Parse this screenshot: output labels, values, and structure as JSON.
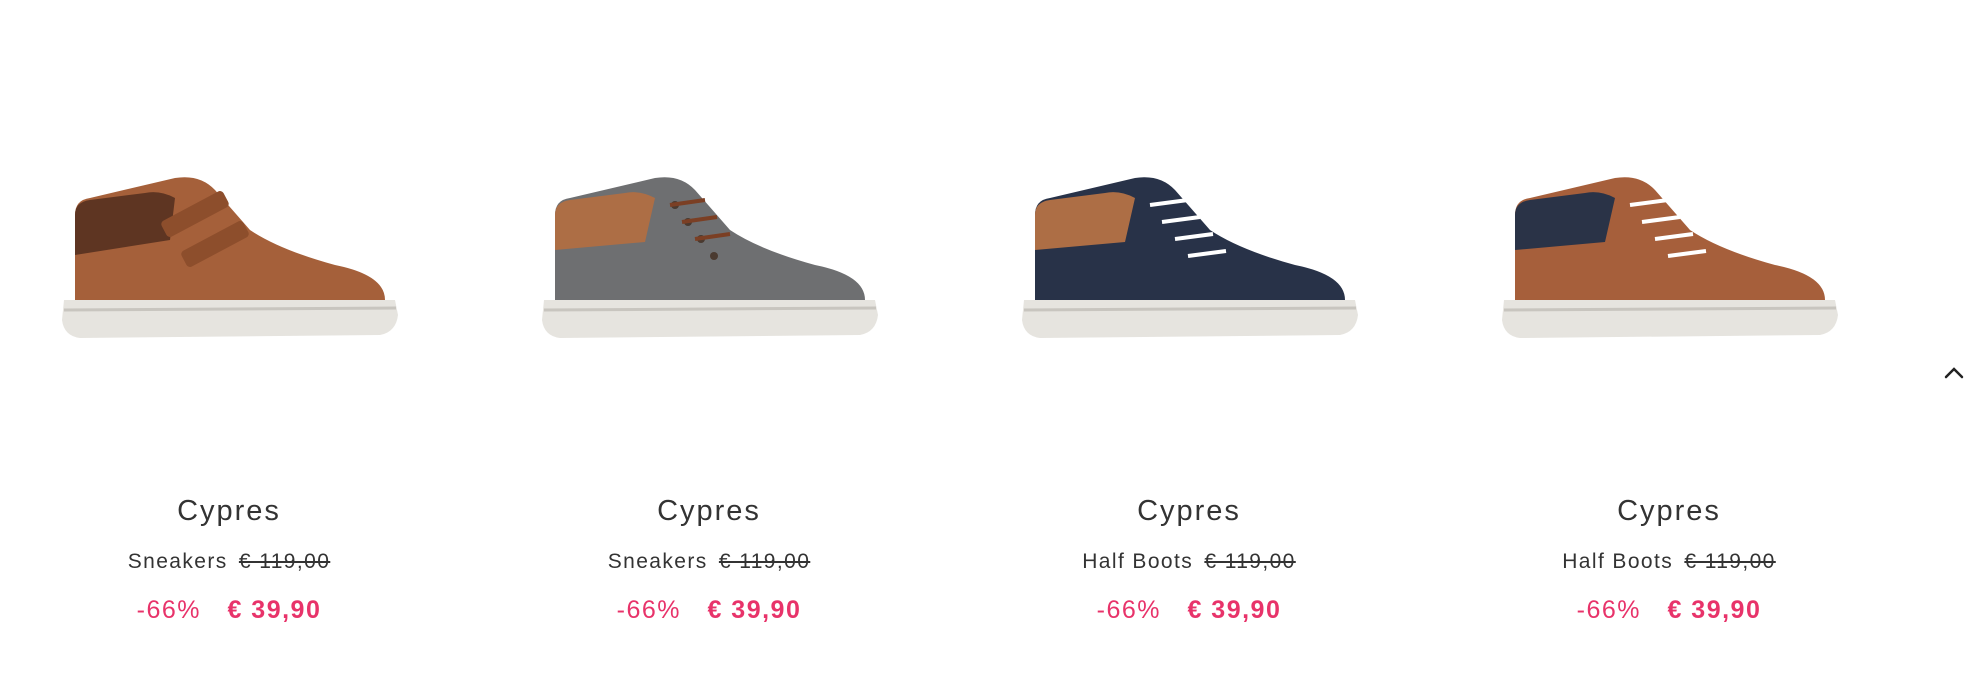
{
  "products": [
    {
      "brand": "Cypres",
      "type": "Sneakers",
      "old_price": "€ 119,00",
      "discount": "-66%",
      "new_price": "€ 39,90",
      "colors": {
        "upper": "#a5603a",
        "collar": "#5e3522",
        "sole": "#e6e4df"
      }
    },
    {
      "brand": "Cypres",
      "type": "Sneakers",
      "old_price": "€ 119,00",
      "discount": "-66%",
      "new_price": "€ 39,90",
      "colors": {
        "upper": "#6e6f71",
        "collar": "#ad6e45",
        "sole": "#e6e4df"
      }
    },
    {
      "brand": "Cypres",
      "type": "Half Boots",
      "old_price": "€ 119,00",
      "discount": "-66%",
      "new_price": "€ 39,90",
      "colors": {
        "upper": "#283248",
        "collar": "#ad6e45",
        "sole": "#e6e4df"
      }
    },
    {
      "brand": "Cypres",
      "type": "Half Boots",
      "old_price": "€ 119,00",
      "discount": "-66%",
      "new_price": "€ 39,90",
      "colors": {
        "upper": "#a65f3b",
        "collar": "#2a3347",
        "sole": "#e6e4df"
      }
    }
  ],
  "accent_color": "#e8336a",
  "scroll_top_icon": "chevron-up-icon"
}
